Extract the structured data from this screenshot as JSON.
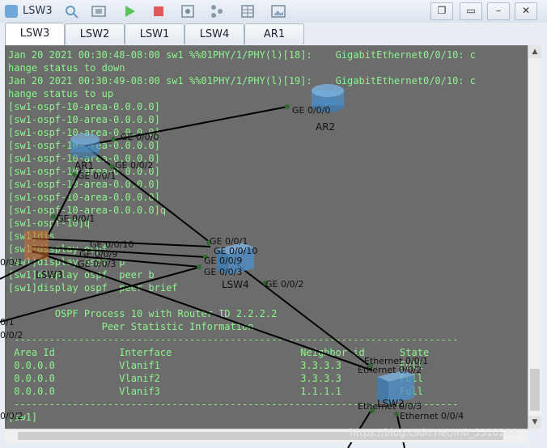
{
  "window": {
    "title": "LSW3"
  },
  "toolbar": {
    "buttons": [
      "settings-icon",
      "refresh-icon",
      "screen-icon",
      "play-icon",
      "stop-icon",
      "capture-icon",
      "topology-icon",
      "table-icon",
      "image-icon"
    ]
  },
  "tabs": [
    {
      "label": "LSW3",
      "active": true
    },
    {
      "label": "LSW2",
      "active": false
    },
    {
      "label": "LSW1",
      "active": false
    },
    {
      "label": "LSW4",
      "active": false
    },
    {
      "label": "AR1",
      "active": false
    }
  ],
  "console": {
    "lines": [
      "Jan 20 2021 00:30:48-08:00 sw1 %%01PHY/1/PHY(l)[18]:    GigabitEthernet0/0/10: c",
      "hange status to down",
      "Jan 20 2021 00:30:49-08:00 sw1 %%01PHY/1/PHY(l)[19]:    GigabitEthernet0/0/10: c",
      "hange status to up",
      "[sw1-ospf-10-area-0.0.0.0]",
      "[sw1-ospf-10-area-0.0.0.0]",
      "[sw1-ospf-10-area-0.0.0.0]",
      "[sw1-ospf-10-area-0.0.0.0]",
      "[sw1-ospf-10-area-0.0.0.0]",
      "[sw1-ospf-10-area-0.0.0.0]",
      "[sw1-ospf-10-area-0.0.0.0]",
      "[sw1-ospf-10-area-0.0.0.0]",
      "[sw1-ospf-10-area-0.0.0.0]q",
      "[sw1-ospf-10]q",
      "[sw1]dis",
      "[sw1]display ospf",
      "[sw1]display ospf  p",
      "[sw1]display ospf  peer b",
      "[sw1]display ospf  peer brief",
      "",
      "",
      "        OSPF Process 10 with Router ID 2.2.2.2",
      "                Peer Statistic Information",
      " ----------------------------------------------------------------------------",
      " Area Id           Interface                      Neighbor id      State",
      " 0.0.0.0           Vlanif1                        3.3.3.3          Full",
      " 0.0.0.0           Vlanif2                        3.3.3.3          Full",
      " 0.0.0.0           Vlanif3                        1.1.1.1          Full",
      " ----------------------------------------------------------------------------",
      "[sw1]"
    ]
  },
  "topology": {
    "devices": [
      {
        "id": "AR2",
        "label": "AR2"
      },
      {
        "id": "AR1",
        "label": "AR1"
      },
      {
        "id": "LSW4",
        "label": "LSW4"
      },
      {
        "id": "LSW3",
        "label": "LSW3"
      },
      {
        "id": "LSW2",
        "label": "LSW2"
      }
    ],
    "port_labels": [
      "GE 0/0/0",
      "GE 0/0/0",
      "GE 0/0/2",
      "GE 0/0/1",
      "GE 0/0/1",
      "GE 0/0/10",
      "GE 0/0/9",
      "GE 0/0/3",
      "GE 0/0/1",
      "GE 0/0/10",
      "GE 0/0/9",
      "GE 0/0/3",
      "GE 0/0/2",
      "Ethernet 0/0/1",
      "Ethernet 0/0/2",
      "Ethernet 0/0/3",
      "Ethernet 0/0/4",
      "0/0/1",
      "0/0/2",
      "0/0/2",
      "0/1"
    ]
  },
  "watermark": "https://blog.csdn.net/m0_5310244",
  "colors": {
    "console_bg": "#6c6c6c",
    "console_text": "#8cf58c",
    "link": "#000000"
  }
}
